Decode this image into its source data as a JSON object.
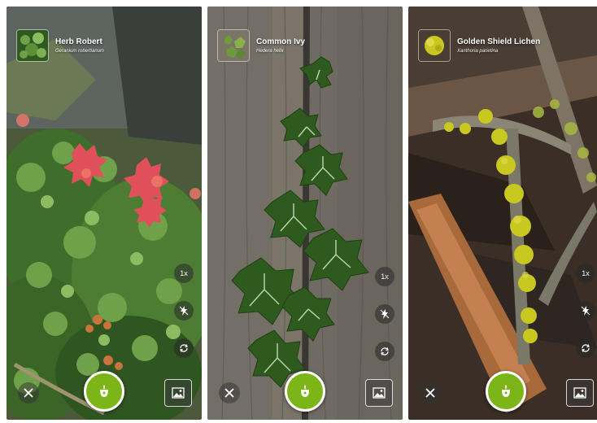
{
  "screens": [
    {
      "common_name": "Herb Robert",
      "scientific_name": "Geranium robertianum",
      "thumbnail_icon": "herb-robert-plant",
      "side_controls": [
        "1x",
        "flash-off-icon",
        "rotate-camera-icon"
      ]
    },
    {
      "common_name": "Common Ivy",
      "scientific_name": "Hedera helix",
      "thumbnail_icon": "ivy-plant",
      "side_controls": [
        "1x",
        "flash-off-icon",
        "rotate-camera-icon"
      ]
    },
    {
      "common_name": "Golden Shield Lichen",
      "scientific_name": "Xanthoria parietina",
      "thumbnail_icon": "lichen",
      "side_controls": [
        "1x",
        "flash-off-icon",
        "rotate-camera-icon"
      ]
    }
  ],
  "zoom_label": "1x",
  "controls": {
    "close_icon": "close-icon",
    "shutter_icon": "plant-scan-icon",
    "gallery_icon": "gallery-icon"
  },
  "colors": {
    "shutter_green": "#7cb518",
    "ivy_leaf": "#2f5a1e",
    "herb_red": "#e0505a",
    "lichen_yellow": "#c8c820"
  }
}
